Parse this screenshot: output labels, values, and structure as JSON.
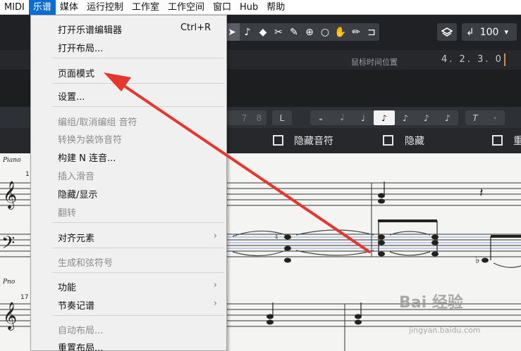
{
  "menubar": {
    "items": [
      {
        "label": "MIDI"
      },
      {
        "label": "乐谱",
        "active": true
      },
      {
        "label": "媒体"
      },
      {
        "label": "运行控制"
      },
      {
        "label": "工作室"
      },
      {
        "label": "工作空间"
      },
      {
        "label": "窗口"
      },
      {
        "label": "Hub"
      },
      {
        "label": "帮助"
      }
    ]
  },
  "toolbar": {
    "tools": [
      {
        "icon": "pointer-icon",
        "glyph": "➤"
      },
      {
        "icon": "note-icon",
        "glyph": "♪"
      },
      {
        "icon": "eraser-icon",
        "glyph": "◆"
      },
      {
        "icon": "scissors-icon",
        "glyph": "✂"
      },
      {
        "icon": "glue-icon",
        "glyph": "✎"
      },
      {
        "icon": "zoom-icon",
        "glyph": "⊕"
      },
      {
        "icon": "search-icon",
        "glyph": "○"
      },
      {
        "icon": "hand-icon",
        "glyph": "✋"
      },
      {
        "icon": "pencil-icon",
        "glyph": "✏"
      },
      {
        "icon": "split-icon",
        "glyph": "⊐"
      }
    ],
    "tempo_value": "100",
    "tempo_glyph": "↲",
    "dropdown_glyph": "▾"
  },
  "infobar": {
    "mouse_time_label": "鼠标时间位置",
    "mouse_time_value": "4. 2. 3.   0"
  },
  "notebar": {
    "numbers": [
      "7",
      "8"
    ],
    "l_label": "L",
    "notes": [
      "𝅝",
      "𝅗𝅥",
      "♩",
      "♪",
      "♪",
      "♪",
      "♪"
    ],
    "t_label": "T",
    "dot_label": "·"
  },
  "options": {
    "hide_notes_label": "隐藏音符",
    "hide_label": "隐藏",
    "last_label": "重"
  },
  "score": {
    "instrument1": "Piano",
    "instrument2": "Pno",
    "bar1": "1",
    "bar2": "17"
  },
  "dropdown": {
    "items": [
      {
        "label": "打开乐谱编辑器",
        "shortcut": "Ctrl+R",
        "disabled": false
      },
      {
        "label": "打开布局...",
        "disabled": false
      },
      {
        "label": "页面模式",
        "disabled": false
      },
      {
        "label": "设置...",
        "disabled": false
      },
      {
        "label": "编组/取消编组 音符",
        "disabled": true
      },
      {
        "label": "转换为装饰音符",
        "disabled": true
      },
      {
        "label": "构建 N 连音...",
        "disabled": false
      },
      {
        "label": "插入滑音",
        "disabled": true
      },
      {
        "label": "隐藏/显示",
        "disabled": false
      },
      {
        "label": "翻转",
        "disabled": true
      },
      {
        "label": "对齐元素",
        "submenu": true,
        "disabled": false
      },
      {
        "label": "生成和弦符号",
        "disabled": true
      },
      {
        "label": "功能",
        "submenu": true,
        "disabled": false
      },
      {
        "label": "节奏记谱",
        "submenu": true,
        "disabled": false
      },
      {
        "label": "自动布局...",
        "disabled": true
      },
      {
        "label": "重置布局...",
        "disabled": false
      }
    ],
    "submenu_arrow": "›"
  },
  "watermark": {
    "text": "Bai 经验",
    "url": "jingyan.baidu.com"
  },
  "colors": {
    "menu_highlight": "#0a6ed1",
    "annotation_arrow": "#e8362c"
  }
}
